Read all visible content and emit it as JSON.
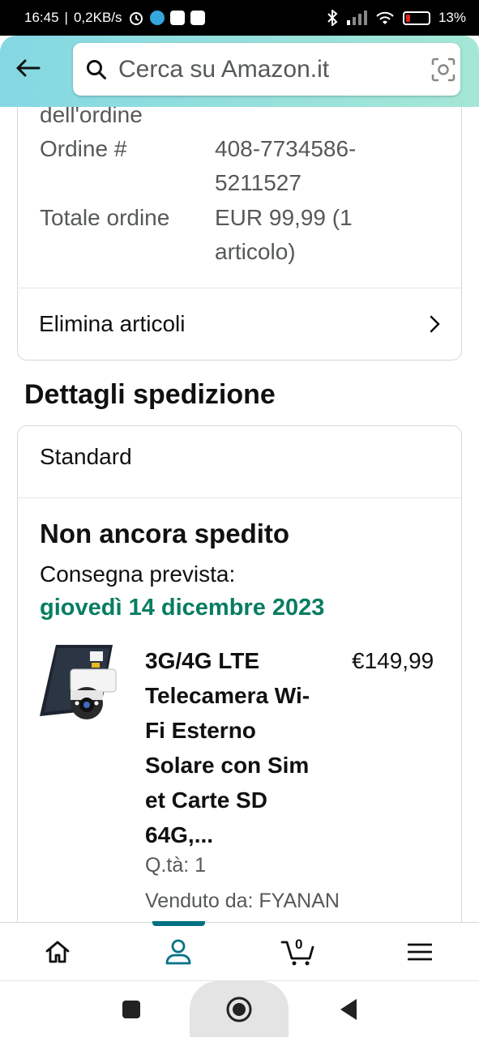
{
  "status_bar": {
    "time": "16:45",
    "speed": "0,2KB/s",
    "battery": "13"
  },
  "search": {
    "placeholder": "Cerca su Amazon.it"
  },
  "order_info": {
    "partial_label": "dell'ordine",
    "order_label": "Ordine #",
    "order_number_line1": "408-7734586-",
    "order_number_line2": "5211527",
    "total_label": "Totale ordine",
    "total_line1": "EUR 99,99 (1",
    "total_line2": "articolo)",
    "delete_items": "Elimina articoli"
  },
  "shipping": {
    "section_title": "Dettagli spedizione",
    "method": "Standard",
    "status": "Non ancora spedito",
    "delivery_label": "Consegna prevista:",
    "delivery_date": "giovedì 14 dicembre 2023",
    "product": {
      "title_lines": [
        "3G/4G LTE",
        "Telecamera Wi-",
        "Fi Esterno",
        "Solare con Sim",
        "et Carte SD",
        "64G,..."
      ],
      "price": "€149,99",
      "quantity": "Q.tà: 1",
      "seller": "Venduto da: FYANAN"
    }
  },
  "bottom_nav": {
    "cart_count": "0",
    "active": "profile"
  },
  "colors": {
    "header_start": "#84d8e3",
    "header_end": "#a5e7d6",
    "delivery_green": "#067d62",
    "nav_active": "#007185"
  }
}
